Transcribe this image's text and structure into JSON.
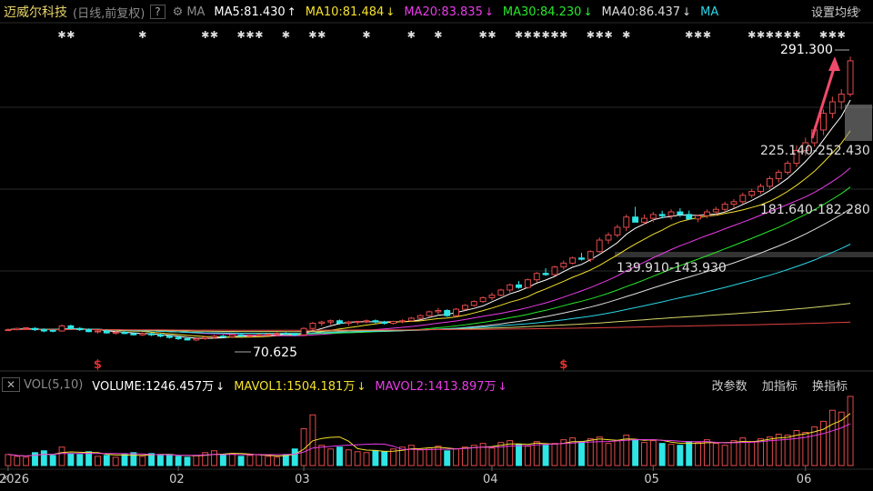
{
  "header": {
    "title": "迈威尔科技",
    "sub": "(日线,前复权)",
    "help": "?",
    "ma_label": "MA",
    "ma": [
      {
        "text": "MA5:81.430",
        "arrow": "↑",
        "color": "#ffffff"
      },
      {
        "text": "MA10:81.484",
        "arrow": "↓",
        "color": "#f5e12d"
      },
      {
        "text": "MA20:83.835",
        "arrow": "↓",
        "color": "#e93ce8"
      },
      {
        "text": "MA30:84.230",
        "arrow": "↓",
        "color": "#27e82a"
      },
      {
        "text": "MA40:86.437",
        "arrow": "↓",
        "color": "#dddddd"
      },
      {
        "text": "MA",
        "arrow": "",
        "color": "#2bd6e6"
      }
    ],
    "settings": "设置均线",
    "scroll_icon": "»"
  },
  "volume_header": {
    "label": "VOL(5,10)",
    "volume": {
      "text": "VOLUME:1246.457万",
      "arrow": "↓",
      "color": "#ffffff"
    },
    "mavol1": {
      "text": "MAVOL1:1504.181万",
      "arrow": "↓",
      "color": "#f5e12d"
    },
    "mavol2": {
      "text": "MAVOL2:1413.897万",
      "arrow": "↓",
      "color": "#e93ce8"
    },
    "tools": [
      "改参数",
      "加指标",
      "换指标"
    ]
  },
  "annotations": {
    "high": "291.300",
    "low": "70.625",
    "band1": "225.140-252.430",
    "band2": "181.640-182.280",
    "band3": "139.910-143.930",
    "dividend_mark": "$"
  },
  "chart_data": {
    "type": "candlestick",
    "y_range": [
      55,
      300
    ],
    "x_labels": [
      "2026",
      "02",
      "03",
      "04",
      "05",
      "06"
    ],
    "x_label_index": [
      0,
      19,
      33,
      54,
      72,
      89
    ],
    "news_marker_days": [
      6,
      7,
      15,
      22,
      23,
      26,
      27,
      28,
      31,
      34,
      35,
      40,
      45,
      48,
      53,
      54,
      57,
      58,
      59,
      60,
      61,
      62,
      65,
      66,
      67,
      69,
      76,
      77,
      78,
      83,
      84,
      85,
      86,
      87,
      88,
      91,
      92,
      93
    ],
    "dividend_days": [
      10,
      62
    ],
    "candles": [
      [
        78,
        79,
        77,
        78
      ],
      [
        78,
        79.5,
        77.5,
        79
      ],
      [
        79,
        80,
        78,
        79.5
      ],
      [
        79,
        80,
        77,
        78
      ],
      [
        78,
        79,
        76,
        77
      ],
      [
        77,
        78,
        76,
        77.5
      ],
      [
        77,
        82,
        76.5,
        81
      ],
      [
        81,
        82,
        78,
        79
      ],
      [
        79,
        80,
        77,
        78
      ],
      [
        78,
        79,
        76,
        76.5
      ],
      [
        76.5,
        78,
        75,
        77
      ],
      [
        77,
        78,
        75,
        75.5
      ],
      [
        75.5,
        77,
        74,
        76
      ],
      [
        76,
        77,
        74.5,
        75
      ],
      [
        75,
        76,
        73.5,
        74
      ],
      [
        74,
        76,
        73,
        75
      ],
      [
        75,
        76,
        73,
        74
      ],
      [
        74,
        75,
        72,
        73
      ],
      [
        73,
        74,
        71,
        72
      ],
      [
        72,
        73,
        70,
        71
      ],
      [
        71,
        72,
        69.5,
        70
      ],
      [
        70,
        72,
        69,
        71
      ],
      [
        71,
        73,
        70,
        72
      ],
      [
        72,
        74,
        71,
        73
      ],
      [
        73,
        74,
        72,
        72.5
      ],
      [
        72.5,
        75,
        71.5,
        74
      ],
      [
        74,
        75,
        72.5,
        73
      ],
      [
        73,
        74,
        72,
        73.5
      ],
      [
        73.5,
        75,
        72.5,
        74
      ],
      [
        74,
        75,
        73,
        74.5
      ],
      [
        74.5,
        76,
        73,
        75
      ],
      [
        75,
        76,
        74,
        74.5
      ],
      [
        74.5,
        75.5,
        73,
        74
      ],
      [
        74,
        80,
        73,
        79
      ],
      [
        79,
        84,
        78,
        83
      ],
      [
        83,
        85,
        81,
        84
      ],
      [
        84,
        86,
        82,
        85
      ],
      [
        85,
        86,
        82,
        83
      ],
      [
        83,
        85,
        81,
        84
      ],
      [
        84,
        85,
        82,
        84.5
      ],
      [
        84.5,
        86,
        83,
        85
      ],
      [
        85,
        86,
        83,
        84
      ],
      [
        84,
        85,
        82,
        83
      ],
      [
        83,
        85,
        82,
        84.5
      ],
      [
        84.5,
        86,
        83,
        85
      ],
      [
        85,
        88,
        84,
        87
      ],
      [
        87,
        90,
        86,
        89
      ],
      [
        89,
        93,
        88,
        92
      ],
      [
        92,
        95,
        90,
        93
      ],
      [
        93,
        94,
        88,
        89
      ],
      [
        89,
        95,
        88,
        94
      ],
      [
        94,
        98,
        93,
        97
      ],
      [
        97,
        101,
        96,
        100
      ],
      [
        100,
        104,
        99,
        103
      ],
      [
        103,
        107,
        101,
        105
      ],
      [
        105,
        110,
        104,
        109
      ],
      [
        109,
        114,
        107,
        113
      ],
      [
        113,
        116,
        110,
        111
      ],
      [
        111,
        118,
        110,
        117
      ],
      [
        117,
        123,
        115,
        122
      ],
      [
        122,
        126,
        120,
        121
      ],
      [
        121,
        128,
        120,
        127
      ],
      [
        127,
        132,
        125,
        130
      ],
      [
        130,
        135,
        129,
        134
      ],
      [
        134,
        138,
        132,
        133
      ],
      [
        133,
        140,
        131,
        139
      ],
      [
        139,
        150,
        138,
        148
      ],
      [
        148,
        154,
        145,
        152
      ],
      [
        152,
        160,
        150,
        158
      ],
      [
        158,
        168,
        155,
        166
      ],
      [
        166,
        174,
        164,
        162
      ],
      [
        162,
        168,
        160,
        165
      ],
      [
        165,
        170,
        162,
        168
      ],
      [
        168,
        171,
        165,
        167
      ],
      [
        167,
        172,
        164,
        170
      ],
      [
        170,
        173,
        166,
        168
      ],
      [
        168,
        171,
        164,
        164.5
      ],
      [
        164.5,
        168,
        162,
        167
      ],
      [
        167,
        172,
        165,
        170
      ],
      [
        170,
        174,
        167,
        172
      ],
      [
        172,
        178,
        170,
        176
      ],
      [
        176,
        180,
        173,
        178
      ],
      [
        178,
        185,
        176,
        183
      ],
      [
        183,
        188,
        181,
        186
      ],
      [
        186,
        192,
        184,
        190
      ],
      [
        190,
        198,
        188,
        196
      ],
      [
        196,
        203,
        193,
        201
      ],
      [
        201,
        210,
        199,
        208
      ],
      [
        208,
        222,
        205,
        218
      ],
      [
        218,
        228,
        214,
        224
      ],
      [
        224,
        237,
        221,
        234
      ],
      [
        234,
        250,
        230,
        247
      ],
      [
        247,
        260,
        243,
        256
      ],
      [
        256,
        266,
        250,
        262
      ],
      [
        262,
        291.3,
        260,
        288
      ]
    ],
    "candle_dir_override": [
      0,
      0,
      0,
      1,
      1,
      1,
      0,
      1,
      1,
      1,
      0,
      1,
      0,
      1,
      1,
      0,
      1,
      1,
      1,
      1,
      1,
      0,
      0,
      0,
      1,
      0,
      1,
      0,
      0,
      0,
      0,
      1,
      1,
      0,
      0,
      0,
      0,
      1,
      0,
      0,
      0,
      1,
      1,
      0,
      0,
      0,
      0,
      0,
      0,
      1,
      0,
      0,
      0,
      0,
      0,
      0,
      0,
      1,
      0,
      0,
      1,
      0,
      0,
      0,
      1,
      0,
      0,
      0,
      0,
      0,
      1,
      0,
      0,
      1,
      0,
      1,
      1,
      0,
      0,
      0,
      0,
      0,
      0,
      0,
      0,
      0,
      0,
      0,
      0,
      0,
      0,
      0,
      0,
      0,
      0
    ],
    "ma_series": [
      {
        "name": "MA5",
        "color": "#ffffff"
      },
      {
        "name": "MA10",
        "color": "#f5e12d"
      },
      {
        "name": "MA20",
        "color": "#e93ce8"
      },
      {
        "name": "MA30",
        "color": "#27e82a"
      },
      {
        "name": "MA40",
        "color": "#dddddd"
      },
      {
        "name": "MA60",
        "color": "#2bd6e6"
      },
      {
        "name": "MA120",
        "color": "#d6d66a"
      },
      {
        "name": "MA250",
        "color": "#e04040"
      }
    ],
    "volume": [
      12,
      10,
      9,
      14,
      16,
      11,
      20,
      13,
      12,
      15,
      10,
      11,
      9,
      12,
      14,
      10,
      13,
      11,
      12,
      10,
      9,
      11,
      14,
      16,
      12,
      13,
      10,
      11,
      12,
      10,
      9,
      12,
      18,
      40,
      55,
      22,
      18,
      20,
      17,
      15,
      14,
      16,
      15,
      18,
      20,
      22,
      17,
      19,
      21,
      16,
      18,
      20,
      22,
      24,
      19,
      25,
      27,
      23,
      21,
      26,
      22,
      24,
      28,
      30,
      26,
      29,
      31,
      24,
      27,
      33,
      28,
      25,
      27,
      24,
      23,
      22,
      26,
      25,
      28,
      24,
      22,
      27,
      30,
      26,
      29,
      31,
      34,
      33,
      38,
      36,
      42,
      48,
      60,
      58,
      75
    ]
  }
}
